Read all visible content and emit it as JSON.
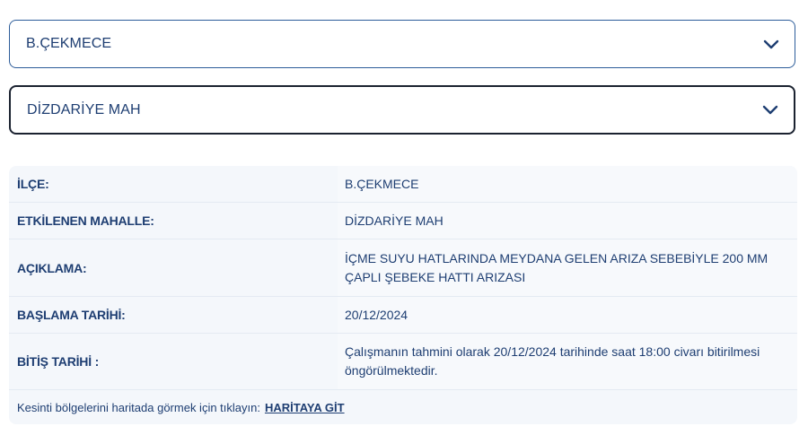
{
  "district_select": {
    "value": "B.ÇEKMECE",
    "icon": "chevron-down-icon"
  },
  "neighborhood_select": {
    "value": "DİZDARİYE MAH",
    "icon": "chevron-down-icon"
  },
  "info": {
    "rows": [
      {
        "label": "İLÇE:",
        "value": "B.ÇEKMECE"
      },
      {
        "label": "ETKİLENEN MAHALLE:",
        "value": "DİZDARİYE MAH"
      },
      {
        "label": "AÇIKLAMA:",
        "value": "İÇME SUYU HATLARINDA MEYDANA GELEN ARIZA SEBEBİYLE 200 MM ÇAPLI ŞEBEKE HATTI ARIZASI"
      },
      {
        "label": "BAŞLAMA TARİHİ:",
        "value": "20/12/2024"
      },
      {
        "label": "BİTİŞ TARİHİ :",
        "value": "Çalışmanın tahmini olarak 20/12/2024 tarihinde saat 18:00 civarı bitirilmesi öngörülmektedir."
      }
    ],
    "footer_text": "Kesinti bölgelerini haritada görmek için tıklayın:",
    "map_link": "HARİTAYA GİT"
  },
  "colors": {
    "text": "#1e3e72",
    "border_primary": "#2d5d9a",
    "border_focus": "#1b2230",
    "table_bg": "#f4f7fb"
  }
}
